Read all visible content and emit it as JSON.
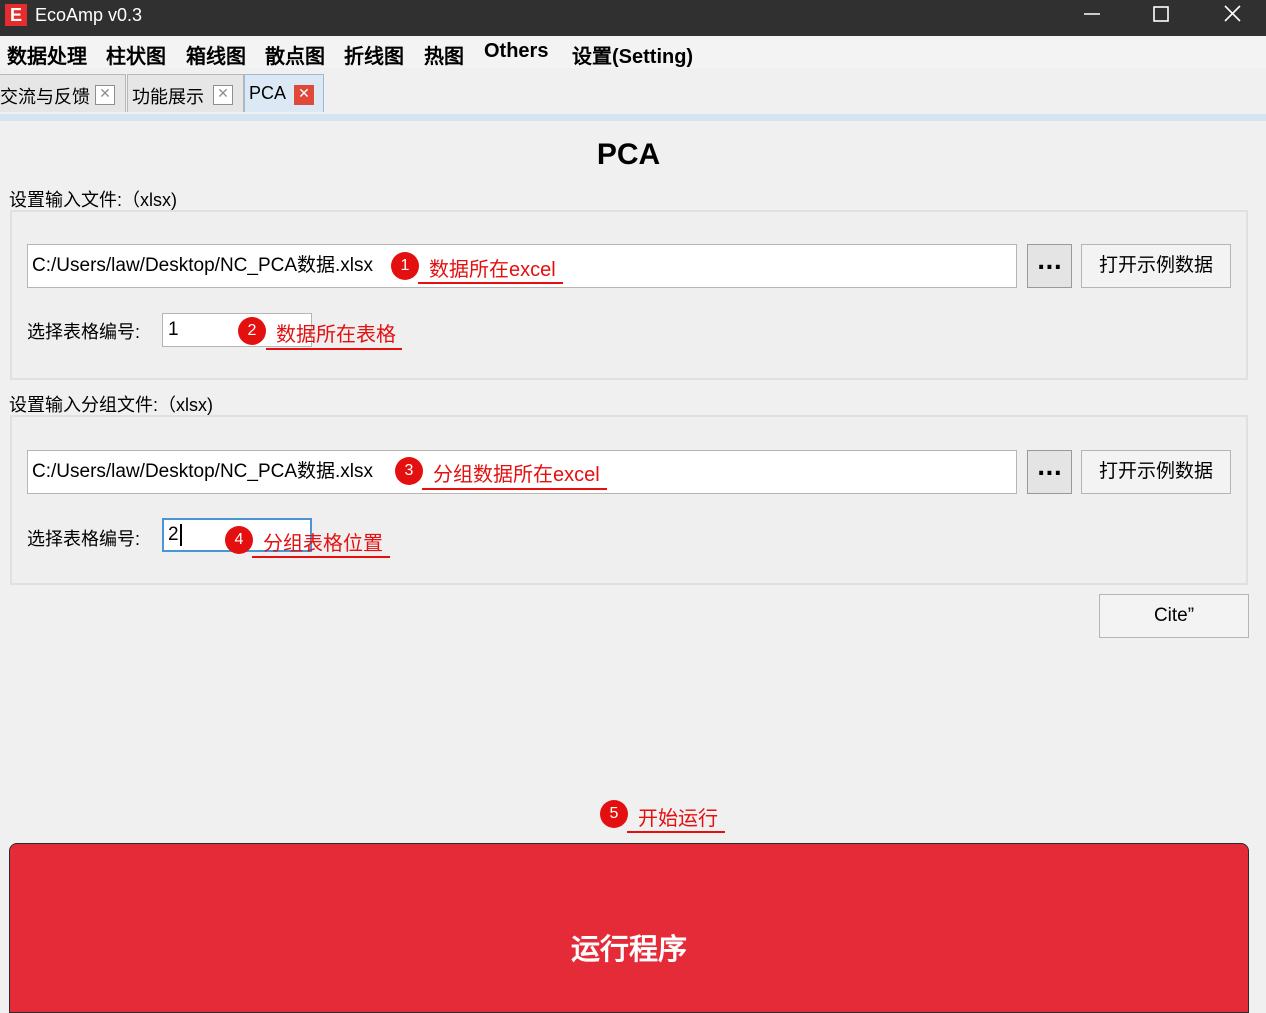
{
  "window": {
    "title": "EcoAmp v0.3",
    "logo_letter": "E",
    "icons": [
      "minimize-icon",
      "maximize-icon",
      "close-icon"
    ]
  },
  "menu": [
    "数据处理",
    "柱状图",
    "箱线图",
    "散点图",
    "折线图",
    "热图",
    "Others",
    "设置(Setting)"
  ],
  "tabs": [
    {
      "label": "交流与反馈",
      "active": false
    },
    {
      "label": "功能展示",
      "active": false
    },
    {
      "label": "PCA",
      "active": true
    }
  ],
  "main": {
    "title": "PCA",
    "input_section": {
      "label": "设置输入文件:（xlsx)",
      "path": "C:/Users/law/Desktop/NC_PCA数据.xlsx",
      "browse_label": "...",
      "example_label": "打开示例数据",
      "sheet_label": "选择表格编号:",
      "sheet_value": "1"
    },
    "group_section": {
      "label": "设置输入分组文件:（xlsx)",
      "path": "C:/Users/law/Desktop/NC_PCA数据.xlsx",
      "browse_label": "...",
      "example_label": "打开示例数据",
      "sheet_label": "选择表格编号:",
      "sheet_value": "2"
    },
    "cite_label": "Cite”",
    "run_label": "运行程序"
  },
  "annotations": [
    {
      "num": "1",
      "text": "数据所在excel"
    },
    {
      "num": "2",
      "text": "数据所在表格"
    },
    {
      "num": "3",
      "text": "分组数据所在excel"
    },
    {
      "num": "4",
      "text": "分组表格位置"
    },
    {
      "num": "5",
      "text": "开始运行"
    }
  ],
  "colors": {
    "titlebar": "#303030",
    "accent_red": "#e52b38",
    "annotation_red": "#e41010",
    "focus_blue": "#4a94d8"
  }
}
